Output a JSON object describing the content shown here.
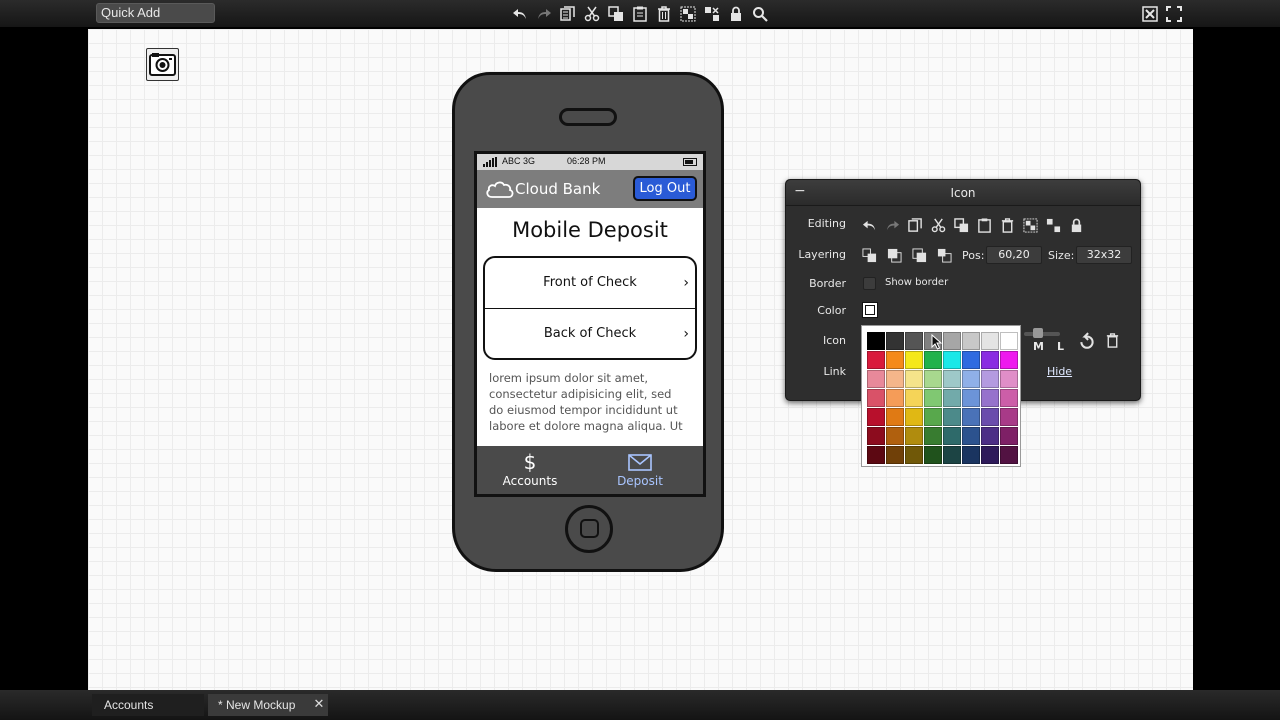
{
  "toolbar": {
    "quick_add_placeholder": "Quick Add"
  },
  "phone": {
    "status": {
      "carrier": "ABC 3G",
      "time": "06:28 PM"
    },
    "navbar": {
      "title": "Cloud Bank",
      "logout_label": "Log Out"
    },
    "screen_title": "Mobile Deposit",
    "checks": [
      {
        "label": "Front of Check"
      },
      {
        "label": "Back of Check"
      }
    ],
    "lorem_lines": [
      "lorem ipsum dolor sit amet,",
      "consectetur adipisicing elit, sed",
      "do eiusmod tempor incididunt ut",
      "labore et dolore magna aliqua. Ut"
    ],
    "tabs": [
      {
        "label": "Accounts",
        "icon": "dollar-icon"
      },
      {
        "label": "Deposit",
        "icon": "envelope-icon"
      }
    ]
  },
  "inspector": {
    "title": "Icon",
    "labels": {
      "editing": "Editing",
      "layering": "Layering",
      "border": "Border",
      "color": "Color",
      "icon": "Icon",
      "link": "Link"
    },
    "pos_label": "Pos:",
    "pos_value": "60,20",
    "size_label": "Size:",
    "size_value": "32x32",
    "show_border_label": "Show border",
    "size_m": "M",
    "size_l": "L",
    "hide_link": "Hide"
  },
  "palette": {
    "colors": [
      "#000000",
      "#333333",
      "#555555",
      "#808080",
      "#a6a6a6",
      "#c8c8c8",
      "#e4e4e4",
      "#ffffff",
      "#d91a3c",
      "#f58a1a",
      "#f5e81a",
      "#22b24c",
      "#1ae8e8",
      "#2f6ae0",
      "#8a2be2",
      "#ee1aee",
      "#e8899a",
      "#f5b68a",
      "#f5e48a",
      "#a8d88e",
      "#9ec8c8",
      "#8fb0e8",
      "#b49ae0",
      "#e08ec8",
      "#d95268",
      "#f59c58",
      "#f5d458",
      "#80c872",
      "#72aaaa",
      "#6c94d8",
      "#9672cc",
      "#cc5ea8",
      "#b8102c",
      "#e07a14",
      "#e0b814",
      "#58a84c",
      "#4c8a8a",
      "#4a72b8",
      "#6a4cac",
      "#a83a88",
      "#8c0c1e",
      "#b0600e",
      "#b08c0e",
      "#387c30",
      "#2e6a6a",
      "#2c528e",
      "#4c2e86",
      "#7e2066",
      "#5c0812",
      "#704008",
      "#705808",
      "#20521c",
      "#1c4444",
      "#1a3460",
      "#2e1a5a",
      "#521242"
    ]
  },
  "bottom_tabs": {
    "accounts": "Accounts",
    "mockup": "* New Mockup"
  }
}
